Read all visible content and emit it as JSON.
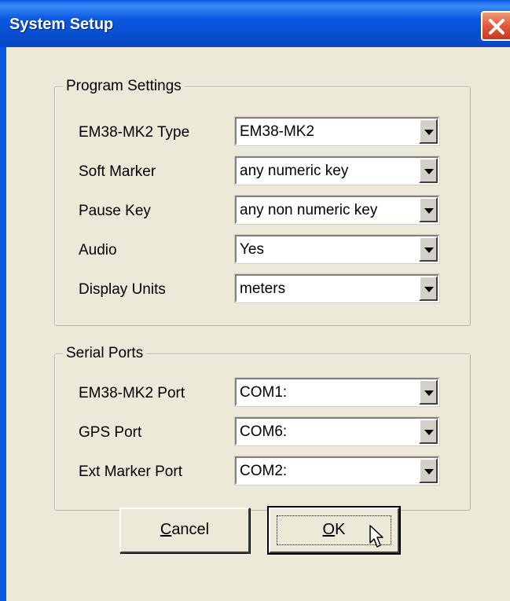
{
  "window": {
    "title": "System Setup"
  },
  "program_settings": {
    "label": "Program Settings",
    "rows": [
      {
        "label": "EM38-MK2 Type",
        "value": "EM38-MK2"
      },
      {
        "label": "Soft Marker",
        "value": "any numeric key"
      },
      {
        "label": "Pause Key",
        "value": "any non numeric key"
      },
      {
        "label": "Audio",
        "value": "Yes"
      },
      {
        "label": "Display Units",
        "value": "meters"
      }
    ]
  },
  "serial_ports": {
    "label": "Serial Ports",
    "rows": [
      {
        "label": "EM38-MK2 Port",
        "value": "COM1:"
      },
      {
        "label": "GPS Port",
        "value": "COM6:"
      },
      {
        "label": "Ext Marker Port",
        "value": "COM2:"
      }
    ]
  },
  "buttons": {
    "cancel": {
      "mnemonic": "C",
      "rest": "ancel"
    },
    "ok": {
      "mnemonic": "O",
      "rest": "K"
    }
  },
  "icons": {
    "close": "close-icon",
    "dropdown": "chevron-down-icon",
    "cursor": "mouse-pointer-icon"
  },
  "colors": {
    "titlebar": "#0a57e1",
    "client": "#ece9d8",
    "close_button": "#e0583a"
  }
}
